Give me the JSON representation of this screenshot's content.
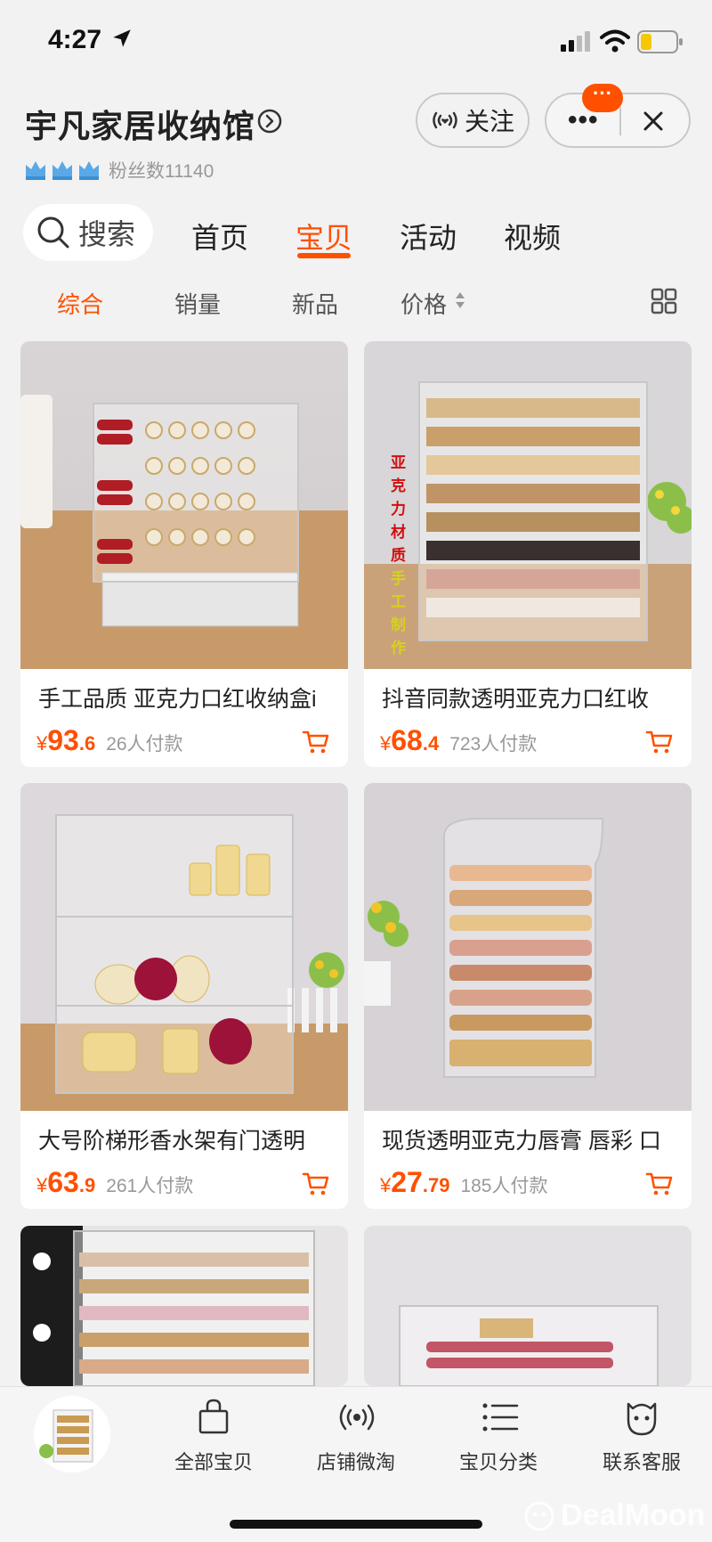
{
  "status_bar": {
    "time": "4:27"
  },
  "header": {
    "shop_name": "宇凡家居收纳馆",
    "fans": "粉丝数11140",
    "follow_label": "关注",
    "capsule_dots": "•••",
    "badge": "···"
  },
  "nav": {
    "search_label": "搜索",
    "tabs": [
      "首页",
      "宝贝",
      "活动",
      "视频"
    ],
    "active_tab": "宝贝"
  },
  "sort": {
    "options": [
      "综合",
      "销量",
      "新品",
      "价格"
    ],
    "active": "综合"
  },
  "products": [
    {
      "title": "手工品质 亚克力口红收纳盒i",
      "currency": "¥",
      "price_int": "93",
      "price_dec": ".6",
      "sold": "26人付款"
    },
    {
      "title": "抖音同款透明亚克力口红收",
      "currency": "¥",
      "price_int": "68",
      "price_dec": ".4",
      "sold": "723人付款"
    },
    {
      "title": "大号阶梯形香水架有门透明",
      "currency": "¥",
      "price_int": "63",
      "price_dec": ".9",
      "sold": "261人付款"
    },
    {
      "title": "现货透明亚克力唇膏 唇彩 口",
      "currency": "¥",
      "price_int": "27",
      "price_dec": ".79",
      "sold": "185人付款"
    }
  ],
  "bottom_nav": [
    {
      "label": "全部宝贝",
      "icon": "shopping-bag-icon"
    },
    {
      "label": "店铺微淘",
      "icon": "broadcast-icon"
    },
    {
      "label": "宝贝分类",
      "icon": "list-icon"
    },
    {
      "label": "联系客服",
      "icon": "customer-service-icon"
    }
  ],
  "watermark": "DealMoon",
  "colors": {
    "accent": "#ff5000",
    "background": "#f2f2f2"
  }
}
